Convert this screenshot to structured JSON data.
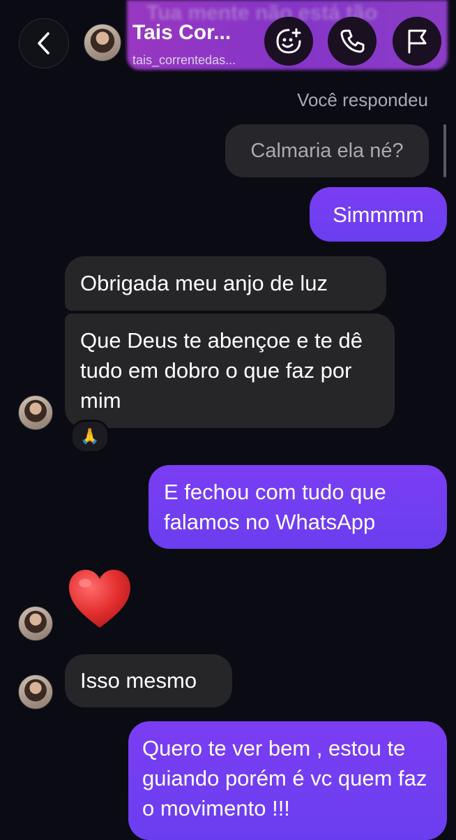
{
  "header": {
    "pinned_preview_text": "Tua mente não está tão",
    "contact_name": "Tais Cor...",
    "username": "tais_correntedas...",
    "back_icon": "chevron-left-icon",
    "gift_icon": "sticker-smile-plus-icon",
    "call_icon": "phone-icon",
    "flag_icon": "flag-icon"
  },
  "reply_context": {
    "label": "Você respondeu",
    "quoted_text": "Calmaria ela né?"
  },
  "messages": [
    {
      "direction": "sent",
      "text": "Simmmm"
    },
    {
      "direction": "received",
      "text": "Obrigada meu anjo de luz"
    },
    {
      "direction": "received",
      "text": "Que Deus te abençoe e te dê tudo em dobro o que faz por mim",
      "reaction": "🙏"
    },
    {
      "direction": "sent",
      "text": "E fechou com tudo que falamos no WhatsApp"
    },
    {
      "direction": "received",
      "emoji": "❤️"
    },
    {
      "direction": "received",
      "text": "Isso mesmo"
    },
    {
      "direction": "sent",
      "text": "Quero te ver bem , estou te guiando porém é vc quem faz o movimento !!!"
    }
  ],
  "colors": {
    "background": "#0b0b14",
    "received_bubble": "#262629",
    "sent_bubble_top": "#9b3ee8",
    "sent_bubble_bottom": "#5745ee",
    "heart": "#e23a3a"
  }
}
